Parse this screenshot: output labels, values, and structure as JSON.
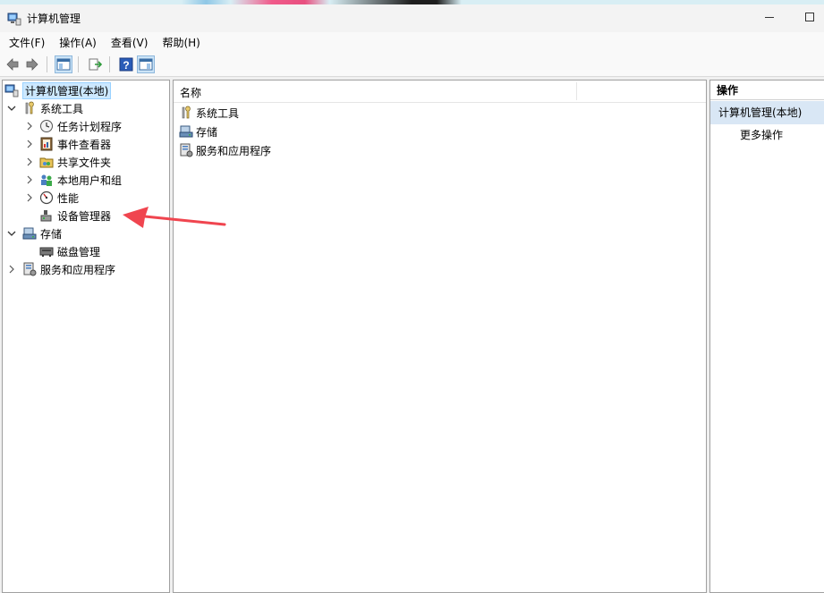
{
  "window": {
    "title": "计算机管理",
    "icon": "computer-management-icon"
  },
  "menu": {
    "items": [
      {
        "label": "文件(F)"
      },
      {
        "label": "操作(A)"
      },
      {
        "label": "查看(V)"
      },
      {
        "label": "帮助(H)"
      }
    ]
  },
  "toolbar": {
    "buttons": [
      "back-arrow-icon",
      "forward-arrow-icon",
      "show-hide-tree-icon",
      "export-list-icon",
      "help-icon",
      "show-hide-action-pane-icon"
    ]
  },
  "tree": {
    "root": {
      "label": "计算机管理(本地)",
      "icon": "computer-management-icon",
      "selected": true
    },
    "system_tools": {
      "label": "系统工具",
      "icon": "tools-icon",
      "expanded": true
    },
    "task_scheduler": {
      "label": "任务计划程序",
      "icon": "clock-icon"
    },
    "event_viewer": {
      "label": "事件查看器",
      "icon": "event-viewer-icon"
    },
    "shared_folders": {
      "label": "共享文件夹",
      "icon": "shared-folder-icon"
    },
    "local_users": {
      "label": "本地用户和组",
      "icon": "users-icon"
    },
    "performance": {
      "label": "性能",
      "icon": "performance-icon"
    },
    "device_manager": {
      "label": "设备管理器",
      "icon": "device-manager-icon"
    },
    "storage": {
      "label": "存储",
      "icon": "storage-icon",
      "expanded": true
    },
    "disk_management": {
      "label": "磁盘管理",
      "icon": "disk-icon"
    },
    "services_apps": {
      "label": "服务和应用程序",
      "icon": "services-icon",
      "expanded": false
    }
  },
  "center": {
    "column_name": "名称",
    "items": [
      {
        "label": "系统工具",
        "icon": "tools-icon"
      },
      {
        "label": "存储",
        "icon": "storage-icon"
      },
      {
        "label": "服务和应用程序",
        "icon": "services-icon"
      }
    ]
  },
  "actions": {
    "title": "操作",
    "section": "计算机管理(本地)",
    "more": "更多操作"
  },
  "colors": {
    "selection": "#cce8ff",
    "action_section_bg": "#d9e7f5",
    "annotation_arrow": "#f0454f"
  }
}
